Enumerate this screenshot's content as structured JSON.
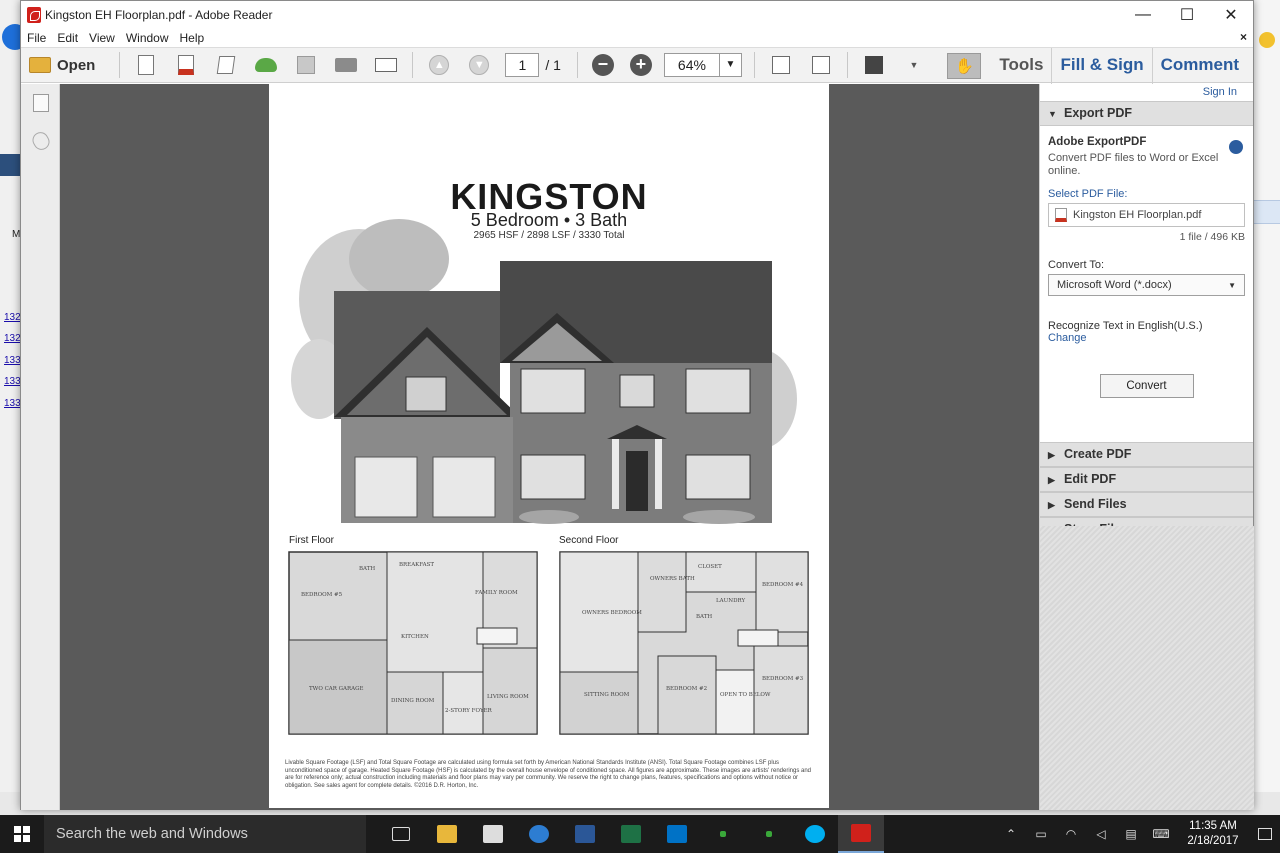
{
  "window": {
    "title": "Kingston EH Floorplan.pdf - Adobe Reader",
    "minimize": "—",
    "maximize": "☐",
    "close": "✕"
  },
  "menu": {
    "items": [
      "File",
      "Edit",
      "View",
      "Window",
      "Help"
    ],
    "close_doc": "×"
  },
  "toolbar": {
    "open_label": "Open",
    "page_current": "1",
    "page_total": "/ 1",
    "zoom": "64%",
    "tools_label": "Tools",
    "fill_sign_label": "Fill & Sign",
    "comment_label": "Comment"
  },
  "document": {
    "title": "KINGSTON",
    "subtitle": "5 Bedroom • 3 Bath",
    "square_footage": "2965 HSF / 2898 LSF / 3330 Total",
    "first_floor_label": "First Floor",
    "second_floor_label": "Second Floor",
    "first_floor_rooms": [
      "BEDROOM #5",
      "BATH",
      "BREAKFAST",
      "FAMILY ROOM",
      "KITCHEN",
      "TWO CAR GARAGE",
      "DINING ROOM",
      "2-STORY FOYER",
      "LIVING ROOM"
    ],
    "second_floor_rooms": [
      "OWNERS BEDROOM",
      "OWNERS BATH",
      "CLOSET",
      "BEDROOM #4",
      "LAUNDRY",
      "BATH",
      "SITTING ROOM",
      "BEDROOM #2",
      "OPEN TO BELOW",
      "BEDROOM #3"
    ],
    "disclaimer": "Livable Square Footage (LSF) and Total Square Footage are calculated using formula set forth by American National Standards Institute (ANSI). Total Square Footage combines LSF plus unconditioned space of garage. Heated Square Footage (HSF) is calculated by the overall house envelope of conditioned space. All figures are approximate. These images are artists' renderings and are for reference only; actual construction including materials and floor plans may vary per community. We reserve the right to change plans, features, specifications and options without notice or obligation. See sales agent for complete details. ©2016 D.R. Horton, Inc."
  },
  "right_pane": {
    "sign_in": "Sign In",
    "export_header": "Export PDF",
    "export_title": "Adobe ExportPDF",
    "export_desc": "Convert PDF files to Word or Excel online.",
    "select_label": "Select PDF File:",
    "file_name": "Kingston EH Floorplan.pdf",
    "file_size": "1 file / 496 KB",
    "convert_to_label": "Convert To:",
    "convert_to_value": "Microsoft Word (*.docx)",
    "recognize_text": "Recognize Text in English(U.S.)",
    "change_link": "Change",
    "convert_button": "Convert",
    "sections": [
      "Create PDF",
      "Edit PDF",
      "Send Files",
      "Store Files"
    ]
  },
  "background": {
    "links": [
      "132",
      "132",
      "133",
      "133",
      "133"
    ],
    "left_letter": "M"
  },
  "taskbar": {
    "search_placeholder": "Search the web and Windows",
    "time": "11:35 AM",
    "date": "2/18/2017"
  }
}
